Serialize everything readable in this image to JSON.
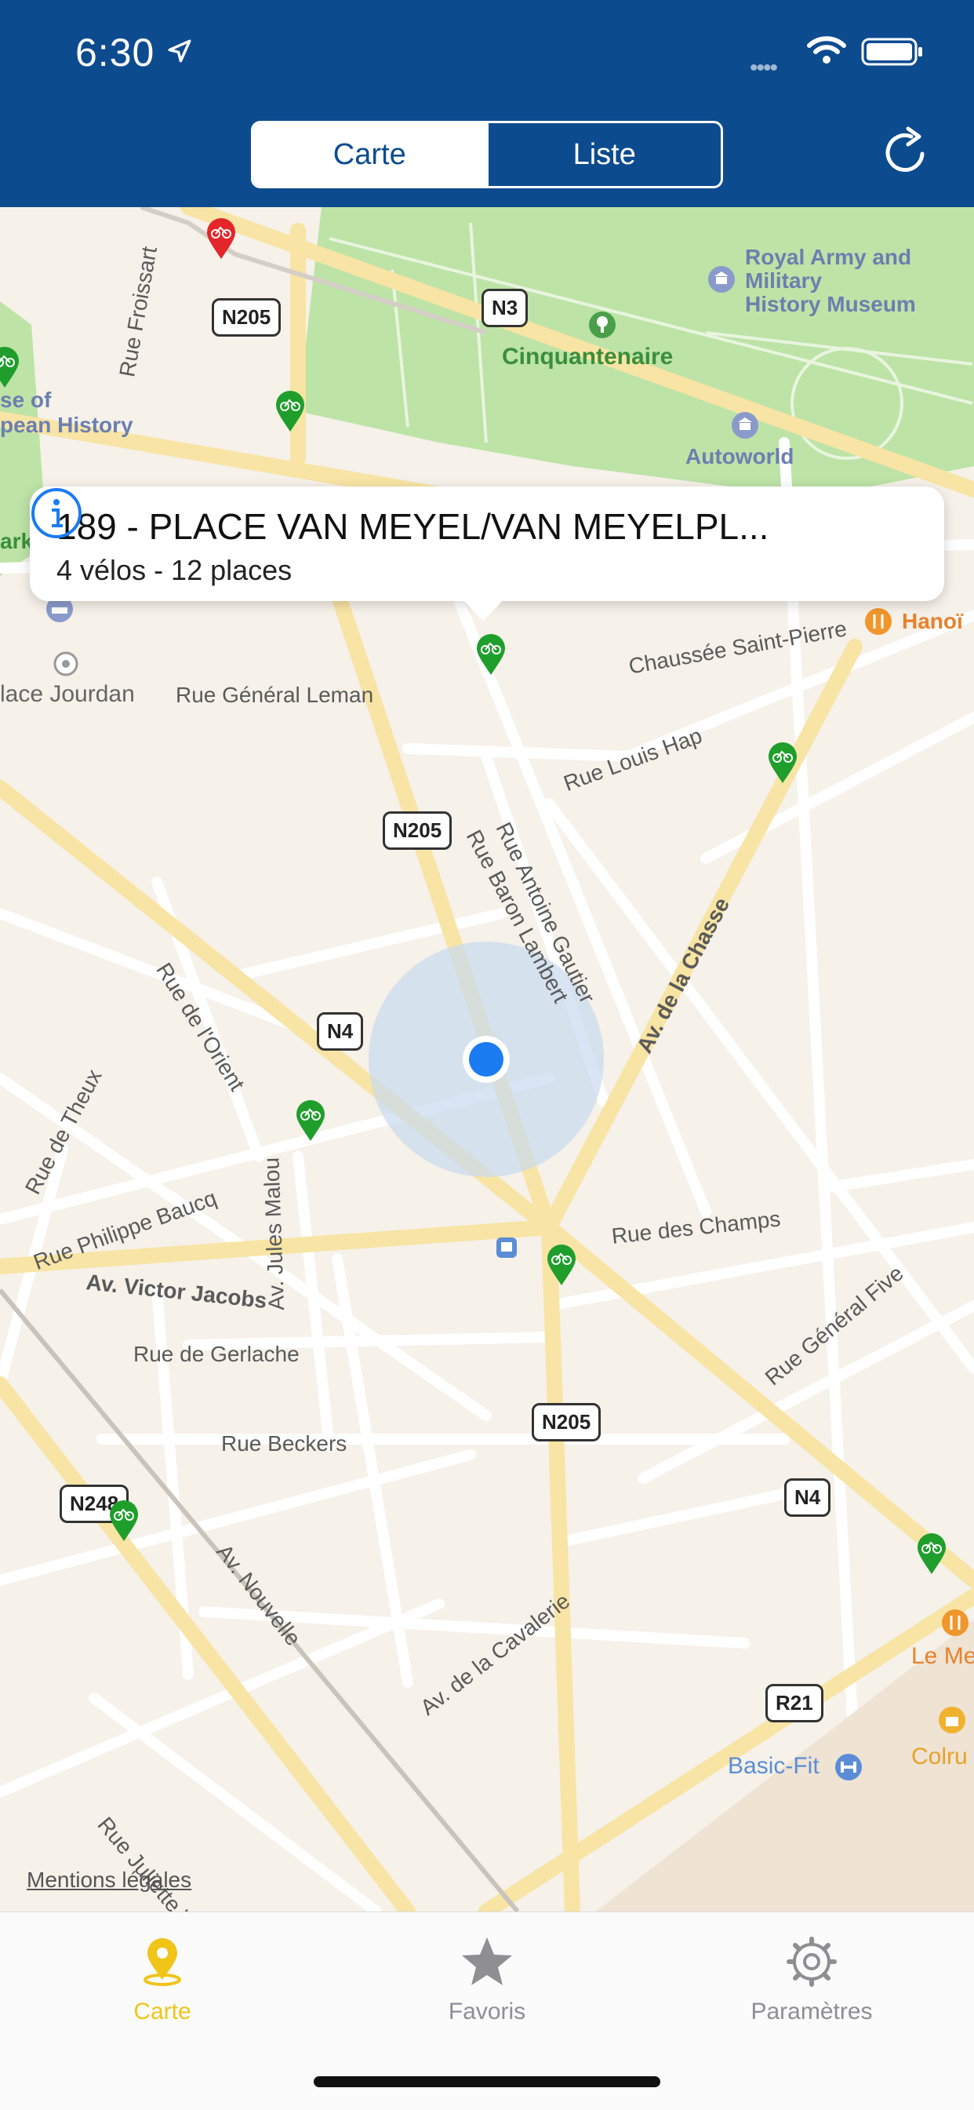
{
  "status": {
    "time": "6:30",
    "signal": "••••"
  },
  "header": {
    "segments": [
      {
        "label": "Carte",
        "active": true
      },
      {
        "label": "Liste",
        "active": false
      }
    ],
    "refresh_icon": "refresh-icon"
  },
  "map": {
    "streets": [
      "Rue Froissart",
      "Rue Général Leman",
      "Chaussée Saint-Pierre",
      "Rue Louis Hap",
      "Rue Baron Lambert",
      "Rue Antoine Gautier",
      "Av. de la Chasse",
      "Rue de l'Orient",
      "Rue de Theux",
      "Av. Jules Malou",
      "Rue Philippe Baucq",
      "Av. Victor Jacobs",
      "Rue des Champs",
      "Rue Général Five",
      "Rue de Gerlache",
      "Rue Beckers",
      "Av. Nouvelle",
      "Av. de la Cavalerie",
      "Rue Juliette Wyt"
    ],
    "places": {
      "cinquantenaire": "Cinquantenaire",
      "royal_army_1": "Royal Army and",
      "royal_army_2": "Military",
      "royal_army_3": "History Museum",
      "autoworld": "Autoworld",
      "house_1": "se of",
      "house_2": "pean History",
      "park": "ark",
      "place_jourdan": "lace Jourdan",
      "hanoi": "Hanoï",
      "basic_fit": "Basic-Fit",
      "le_me": "Le Me",
      "colru": "Colru"
    },
    "shields": [
      "N205",
      "N3",
      "N205",
      "N4",
      "N205",
      "N4",
      "N248",
      "R21"
    ],
    "legal_link": "Mentions légales"
  },
  "callout": {
    "title": "189 - PLACE VAN MEYEL/VAN MEYELPL...",
    "subtitle": "4 vélos - 12 places"
  },
  "tabbar": {
    "tabs": [
      {
        "label": "Carte",
        "icon": "map-pin-icon",
        "active": true
      },
      {
        "label": "Favoris",
        "icon": "star-icon",
        "active": false
      },
      {
        "label": "Paramètres",
        "icon": "gear-icon",
        "active": false
      }
    ]
  },
  "colors": {
    "header": "#0d4b8f",
    "active_tab": "#f0c419",
    "inactive_tab": "#8e8e93",
    "pin_green": "#1f9e2c",
    "pin_red": "#e3262a",
    "user_location": "#1a7cf0"
  }
}
